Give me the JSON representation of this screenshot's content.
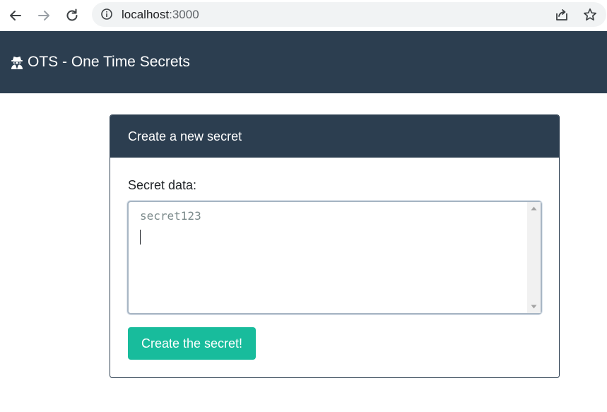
{
  "browser": {
    "url_host": "localhost",
    "url_port": ":3000",
    "icons": {
      "back": "arrow-left-icon",
      "forward": "arrow-right-icon",
      "reload": "reload-icon",
      "site_info": "info-circle-icon",
      "share": "share-icon",
      "bookmark": "star-icon"
    }
  },
  "navbar": {
    "brand_text": "OTS - One Time Secrets",
    "brand_icon": "user-secret-icon",
    "background": "#2c3e50"
  },
  "card": {
    "header": "Create a new secret",
    "field_label": "Secret data:",
    "secret_value": "secret123",
    "submit_label": "Create the secret!",
    "accent": "#18bc9c"
  }
}
